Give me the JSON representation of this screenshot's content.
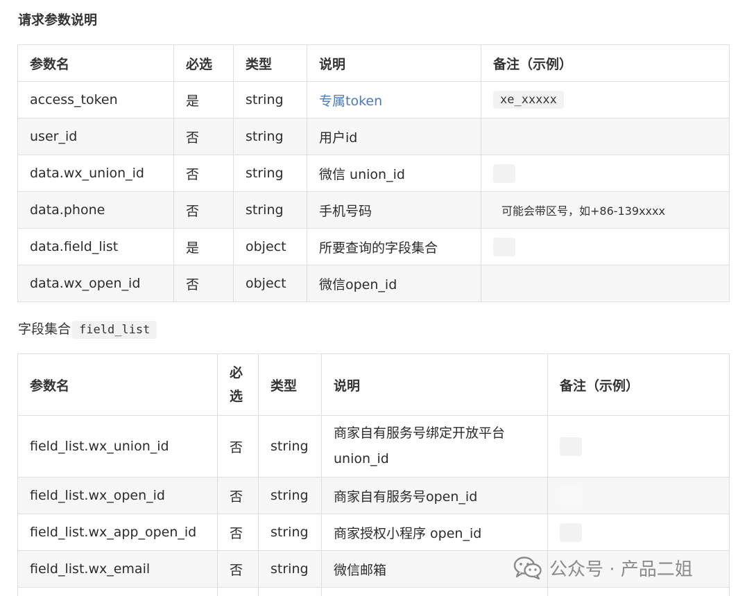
{
  "section1": {
    "title": "请求参数说明",
    "headers": [
      "参数名",
      "必选",
      "类型",
      "说明",
      "备注（示例）"
    ],
    "rows": [
      {
        "name": "access_token",
        "required": "是",
        "type": "string",
        "desc": "专属token",
        "note": "xe_xxxxx"
      },
      {
        "name": "user_id",
        "required": "否",
        "type": "string",
        "desc": "用户id",
        "note": ""
      },
      {
        "name": "data.wx_union_id",
        "required": "否",
        "type": "string",
        "desc": "微信 union_id",
        "note": ""
      },
      {
        "name": "data.phone",
        "required": "否",
        "type": "string",
        "desc": "手机号码",
        "note": "可能会带区号，如+86-139xxxx"
      },
      {
        "name": "data.field_list",
        "required": "是",
        "type": "object",
        "desc": "所要查询的字段集合",
        "note": ""
      },
      {
        "name": "data.wx_open_id",
        "required": "否",
        "type": "object",
        "desc": "微信open_id",
        "note": ""
      }
    ]
  },
  "section2": {
    "title_prefix": "字段集合",
    "title_code": "field_list",
    "headers": [
      "参数名",
      "必选",
      "类型",
      "说明",
      "备注（示例）"
    ],
    "rows": [
      {
        "name": "field_list.wx_union_id",
        "required": "否",
        "type": "string",
        "desc": "商家自有服务号绑定开放平台 union_id",
        "note": ""
      },
      {
        "name": "field_list.wx_open_id",
        "required": "否",
        "type": "string",
        "desc": "商家自有服务号open_id",
        "note": ""
      },
      {
        "name": "field_list.wx_app_open_id",
        "required": "否",
        "type": "string",
        "desc": "商家授权小程序 open_id",
        "note": ""
      },
      {
        "name": "field_list.wx_email",
        "required": "否",
        "type": "string",
        "desc": "微信邮箱",
        "note": ""
      }
    ]
  },
  "watermark": {
    "text": "公众号 · 产品二姐",
    "icon": "wechat-icon"
  }
}
